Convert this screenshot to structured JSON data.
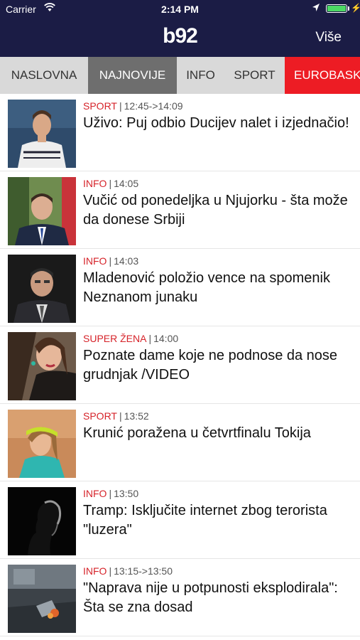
{
  "status": {
    "carrier": "Carrier",
    "time": "2:14 PM"
  },
  "header": {
    "logo": "b92",
    "more_label": "Više"
  },
  "tabs": [
    {
      "label": "NASLOVNA"
    },
    {
      "label": "NAJNOVIJE"
    },
    {
      "label": "INFO"
    },
    {
      "label": "SPORT"
    },
    {
      "label": "EUROBASKET"
    }
  ],
  "articles": [
    {
      "category": "SPORT",
      "time": "12:45->14:09",
      "title": "Uživo: Puj odbio Ducijev nalet i izjednačio!"
    },
    {
      "category": "INFO",
      "time": "14:05",
      "title": "Vučić od ponedeljka u Njujorku - šta može da donese Srbiji"
    },
    {
      "category": "INFO",
      "time": "14:03",
      "title": "Mladenović položio vence na spomenik Neznanom junaku"
    },
    {
      "category": "SUPER ŽENA",
      "time": "14:00",
      "title": "Poznate dame koje ne podnose da nose grudnjak /VIDEO"
    },
    {
      "category": "SPORT",
      "time": "13:52",
      "title": "Krunić poražena u četvrtfinalu Tokija"
    },
    {
      "category": "INFO",
      "time": "13:50",
      "title": "Tramp: Isključite internet zbog terorista \"luzera\""
    },
    {
      "category": "INFO",
      "time": "13:15->13:50",
      "title": "\"Naprava nije u potpunosti eksplodirala\": Šta se zna dosad"
    }
  ],
  "colors": {
    "header_bg": "#1b1c45",
    "accent_red": "#d6232a",
    "tab_active_bg": "#6e6e6e",
    "tab_hot_bg": "#ed1c24",
    "tabs_bg": "#d9d9d9"
  },
  "icons": [
    "wifi-icon",
    "location-icon",
    "battery-icon",
    "charging-icon"
  ]
}
